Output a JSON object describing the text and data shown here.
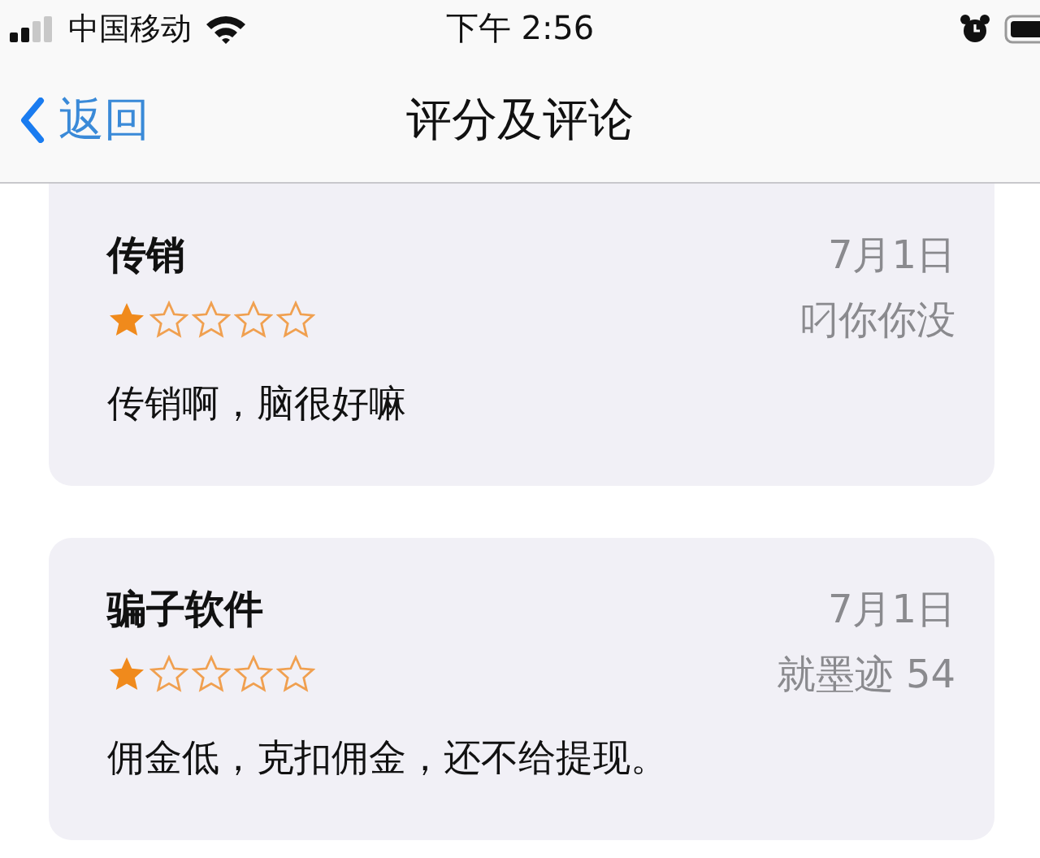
{
  "status_bar": {
    "carrier": "中国移动",
    "time": "下午 2:56"
  },
  "nav_bar": {
    "back": "返回",
    "title": "评分及评论"
  },
  "reviews": [
    {
      "title": "传销",
      "date": "7月1日",
      "author": "叼你你没",
      "stars": 1,
      "body": "传销啊，脑很好嘛",
      "cut_top": true
    },
    {
      "title": "骗子软件",
      "date": "7月1日",
      "author": "就墨迹 54",
      "stars": 1,
      "body": "佣金低，克扣佣金，还不给提现。",
      "cut_top": false
    }
  ]
}
